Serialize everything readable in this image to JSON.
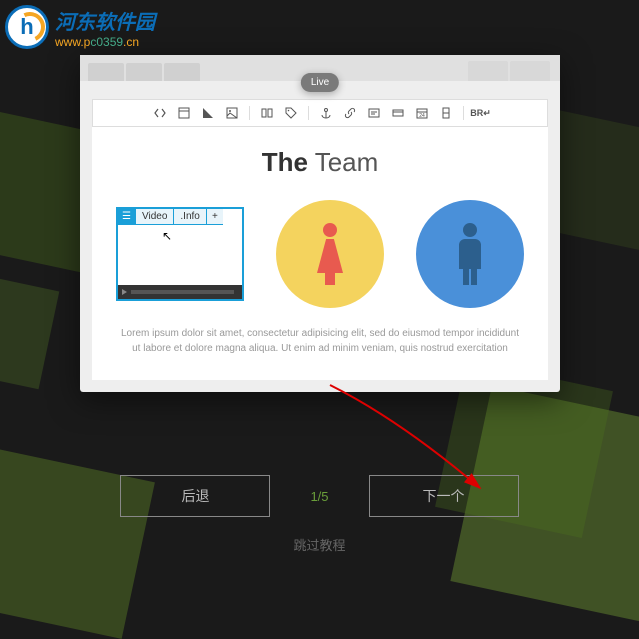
{
  "logo": {
    "cn": "河东软件园",
    "url_1": "www.p",
    "url_2": "c0359",
    "url_3": ".cn"
  },
  "live_label": "Live",
  "video": {
    "tab1": "Video",
    "tab2": ".Info",
    "plus": "+"
  },
  "heading": {
    "bold": "The",
    "rest": " Team"
  },
  "lorem": "Lorem ipsum dolor sit amet, consectetur adipisicing elit, sed do eiusmod tempor incididunt ut labore et dolore magna aliqua. Ut enim ad minim veniam, quis nostrud exercitation",
  "footer": {
    "back": "后退",
    "counter": "1/5",
    "next": "下一个",
    "skip": "跳过教程"
  },
  "colors": {
    "accent": "#1a9fd8",
    "yellow": "#f4d35e",
    "blue": "#4a90d9",
    "red": "#e85a4f"
  }
}
